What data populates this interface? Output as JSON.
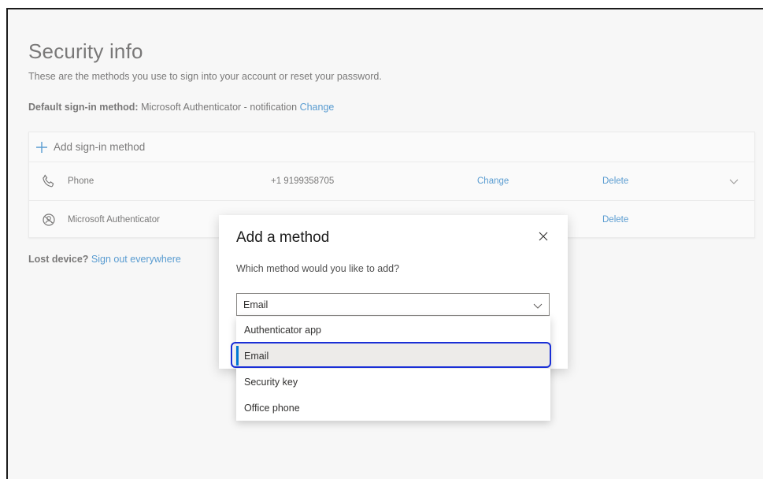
{
  "page": {
    "title": "Security info",
    "subtitle": "These are the methods you use to sign into your account or reset your password.",
    "default_method_label": "Default sign-in method:",
    "default_method_value": "Microsoft Authenticator - notification",
    "default_method_change": "Change"
  },
  "methods": {
    "add_label": "Add sign-in method",
    "rows": [
      {
        "icon": "phone-icon",
        "name": "Phone",
        "detail": "+1 9199358705",
        "change": "Change",
        "delete": "Delete",
        "expand_icon": "chevron-down-icon"
      },
      {
        "icon": "authenticator-icon",
        "name": "Microsoft Authenticator",
        "detail": "",
        "delete": "Delete"
      }
    ]
  },
  "lost_device": {
    "label": "Lost device?",
    "link": "Sign out everywhere"
  },
  "dialog": {
    "title": "Add a method",
    "close_icon": "close-icon",
    "question": "Which method would you like to add?",
    "selected": "Email",
    "options": [
      "Authenticator app",
      "Email",
      "Security key",
      "Office phone"
    ]
  },
  "colors": {
    "link": "#0067b8",
    "accent": "#0078d4",
    "focus": "#1a2fd6",
    "page_bg": "#f3f3f3"
  }
}
